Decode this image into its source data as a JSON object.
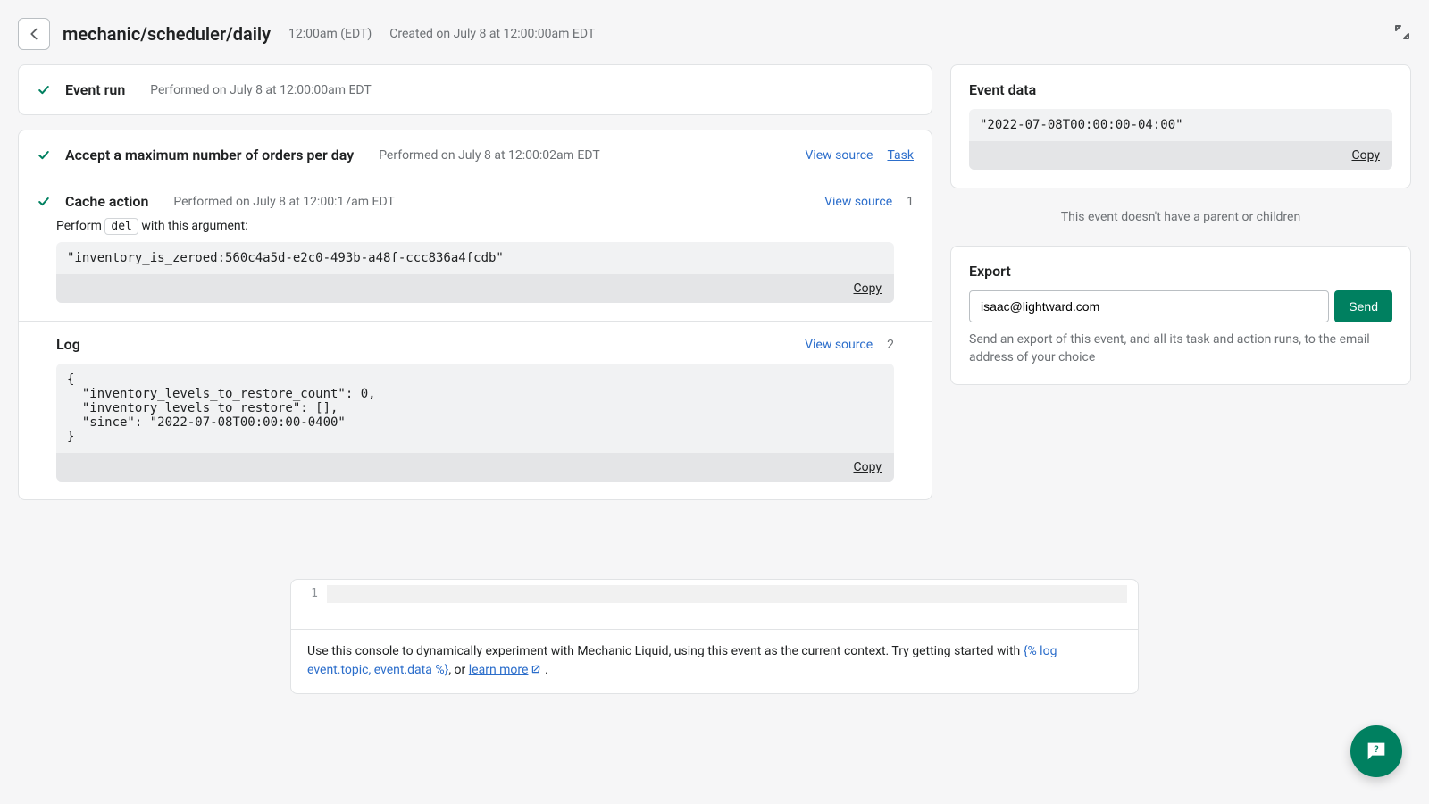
{
  "header": {
    "title": "mechanic/scheduler/daily",
    "time": "12:00am (EDT)",
    "created": "Created on July 8 at 12:00:00am EDT"
  },
  "event_run": {
    "title": "Event run",
    "performed": "Performed on July 8 at 12:00:00am EDT"
  },
  "task": {
    "title": "Accept a maximum number of orders per day",
    "performed": "Performed on July 8 at 12:00:02am EDT",
    "view_source": "View source",
    "task_link": "Task"
  },
  "cache": {
    "title": "Cache action",
    "performed": "Performed on July 8 at 12:00:17am EDT",
    "view_source": "View source",
    "seq": "1",
    "perform_prefix": "Perform",
    "command": "del",
    "perform_suffix": "with this argument:",
    "argument": "\"inventory_is_zeroed:560c4a5d-e2c0-493b-a48f-ccc836a4fcdb\"",
    "copy": "Copy"
  },
  "log": {
    "title": "Log",
    "view_source": "View source",
    "seq": "2",
    "content": "{\n  \"inventory_levels_to_restore_count\": 0,\n  \"inventory_levels_to_restore\": [],\n  \"since\": \"2022-07-08T00:00:00-0400\"\n}",
    "copy": "Copy"
  },
  "event_data": {
    "title": "Event data",
    "content": "\"2022-07-08T00:00:00-04:00\"",
    "copy": "Copy"
  },
  "relation_note": "This event doesn't have a parent or children",
  "export": {
    "title": "Export",
    "email": "isaac@lightward.com",
    "send": "Send",
    "help": "Send an export of this event, and all its task and action runs, to the email address of your choice"
  },
  "console": {
    "line_no": "1",
    "hint_prefix": "Use this console to dynamically experiment with Mechanic Liquid, using this event as the current context. Try getting started with ",
    "liquid": "{% log event.topic, event.data %}",
    "hint_mid": ", or ",
    "learn_more": "learn more",
    "hint_suffix": " ."
  }
}
